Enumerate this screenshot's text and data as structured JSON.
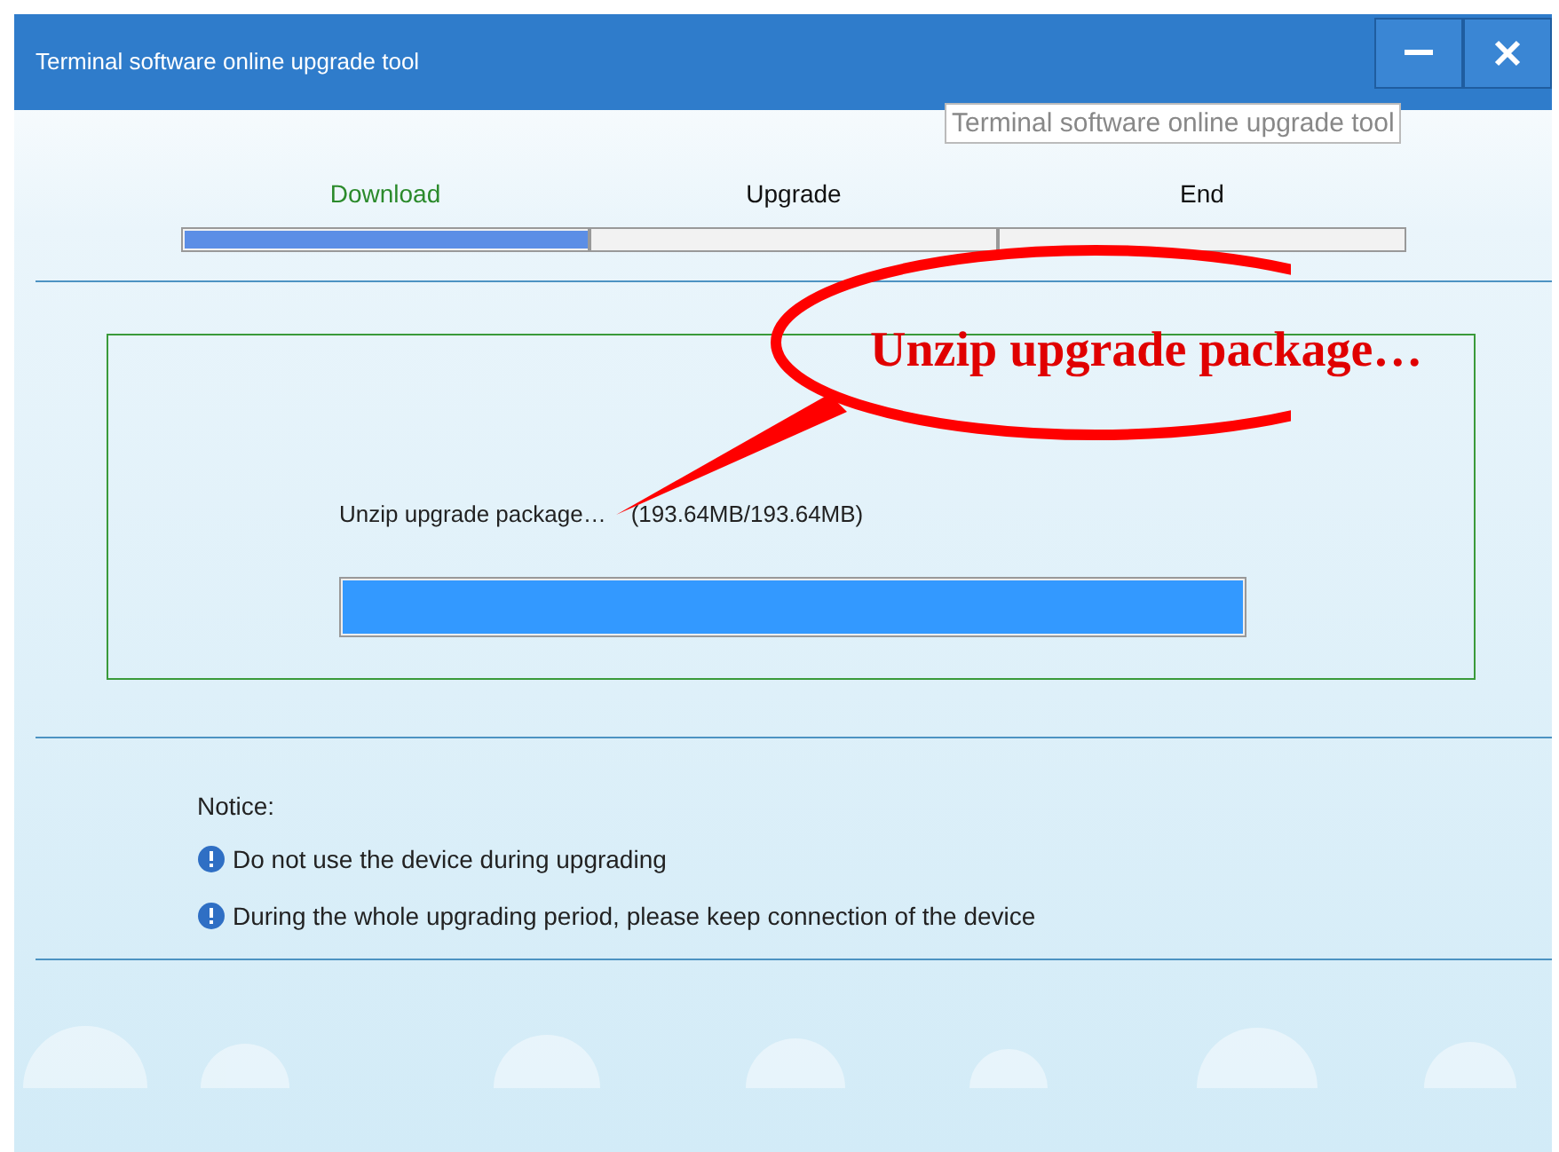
{
  "window": {
    "title": "Terminal software online upgrade tool",
    "tooltip": "Terminal software online upgrade tool"
  },
  "steps": [
    {
      "label": "Download",
      "selected": true
    },
    {
      "label": "Upgrade",
      "selected": false
    },
    {
      "label": "End",
      "selected": false
    }
  ],
  "step_progress": {
    "level": 0.333
  },
  "task": {
    "status": "Unzip upgrade package…",
    "size": "(193.64MB/193.64MB)",
    "level": 1
  },
  "callout": {
    "text": "Unzip upgrade package…"
  },
  "notice": {
    "heading": "Notice:",
    "items": [
      "Do not use the device during upgrading",
      "During the whole upgrading period, please keep connection of the device"
    ]
  }
}
